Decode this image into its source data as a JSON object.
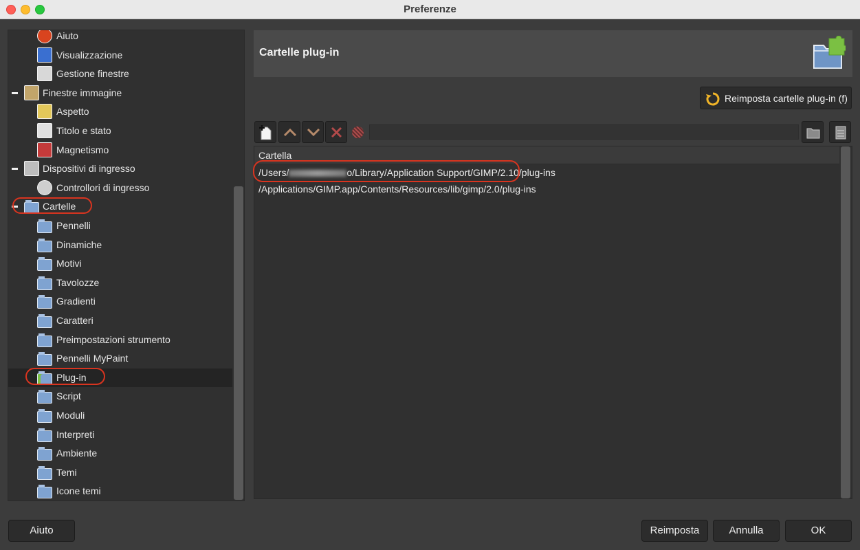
{
  "window": {
    "title": "Preferenze"
  },
  "tree": {
    "items": [
      {
        "label": "Aiuto",
        "level": 1,
        "icon": "help-lifebuoy-icon"
      },
      {
        "label": "Visualizzazione",
        "level": 1,
        "icon": "display-icon"
      },
      {
        "label": "Gestione finestre",
        "level": 1,
        "icon": "window-management-icon"
      },
      {
        "label": "Finestre immagine",
        "level": 0,
        "icon": "image-window-icon",
        "expanded": true
      },
      {
        "label": "Aspetto",
        "level": 1,
        "icon": "appearance-icon"
      },
      {
        "label": "Titolo e stato",
        "level": 1,
        "icon": "title-status-icon"
      },
      {
        "label": "Magnetismo",
        "level": 1,
        "icon": "magnet-icon"
      },
      {
        "label": "Dispositivi di ingresso",
        "level": 0,
        "icon": "input-devices-icon",
        "expanded": true
      },
      {
        "label": "Controllori di ingresso",
        "level": 1,
        "icon": "input-controllers-icon"
      },
      {
        "label": "Cartelle",
        "level": 0,
        "icon": "folders-icon",
        "expanded": true
      },
      {
        "label": "Pennelli",
        "level": 1,
        "icon": "brushes-folder-icon"
      },
      {
        "label": "Dinamiche",
        "level": 1,
        "icon": "dynamics-folder-icon"
      },
      {
        "label": "Motivi",
        "level": 1,
        "icon": "patterns-folder-icon"
      },
      {
        "label": "Tavolozze",
        "level": 1,
        "icon": "palettes-folder-icon"
      },
      {
        "label": "Gradienti",
        "level": 1,
        "icon": "gradients-folder-icon"
      },
      {
        "label": "Caratteri",
        "level": 1,
        "icon": "fonts-folder-icon"
      },
      {
        "label": "Preimpostazioni strumento",
        "level": 1,
        "icon": "tool-presets-folder-icon"
      },
      {
        "label": "Pennelli MyPaint",
        "level": 1,
        "icon": "mypaint-brushes-folder-icon"
      },
      {
        "label": "Plug-in",
        "level": 1,
        "icon": "plugins-folder-icon",
        "selected": true
      },
      {
        "label": "Script",
        "level": 1,
        "icon": "scripts-folder-icon"
      },
      {
        "label": "Moduli",
        "level": 1,
        "icon": "modules-folder-icon"
      },
      {
        "label": "Interpreti",
        "level": 1,
        "icon": "interpreters-folder-icon"
      },
      {
        "label": "Ambiente",
        "level": 1,
        "icon": "environment-folder-icon"
      },
      {
        "label": "Temi",
        "level": 1,
        "icon": "themes-folder-icon"
      },
      {
        "label": "Icone temi",
        "level": 1,
        "icon": "icon-themes-folder-icon"
      }
    ]
  },
  "panel": {
    "title": "Cartelle plug-in",
    "reset_folders_label": "Reimposta cartelle plug-in (f)",
    "path_entry_value": "",
    "list_header": "Cartella",
    "folders": [
      {
        "prefix": "/Users/",
        "suffix": "o/Library/Application Support/GIMP/2.10/plug-ins"
      },
      {
        "prefix": "/Applications/GIMP.app/Contents/Resources/lib/gimp/2.0/plug-ins",
        "suffix": ""
      }
    ]
  },
  "buttons": {
    "help": "Aiuto",
    "reset": "Reimposta",
    "cancel": "Annulla",
    "ok": "OK"
  },
  "colors": {
    "background": "#3c3c3c",
    "annotation": "#d9341f",
    "selection": "#242424"
  }
}
